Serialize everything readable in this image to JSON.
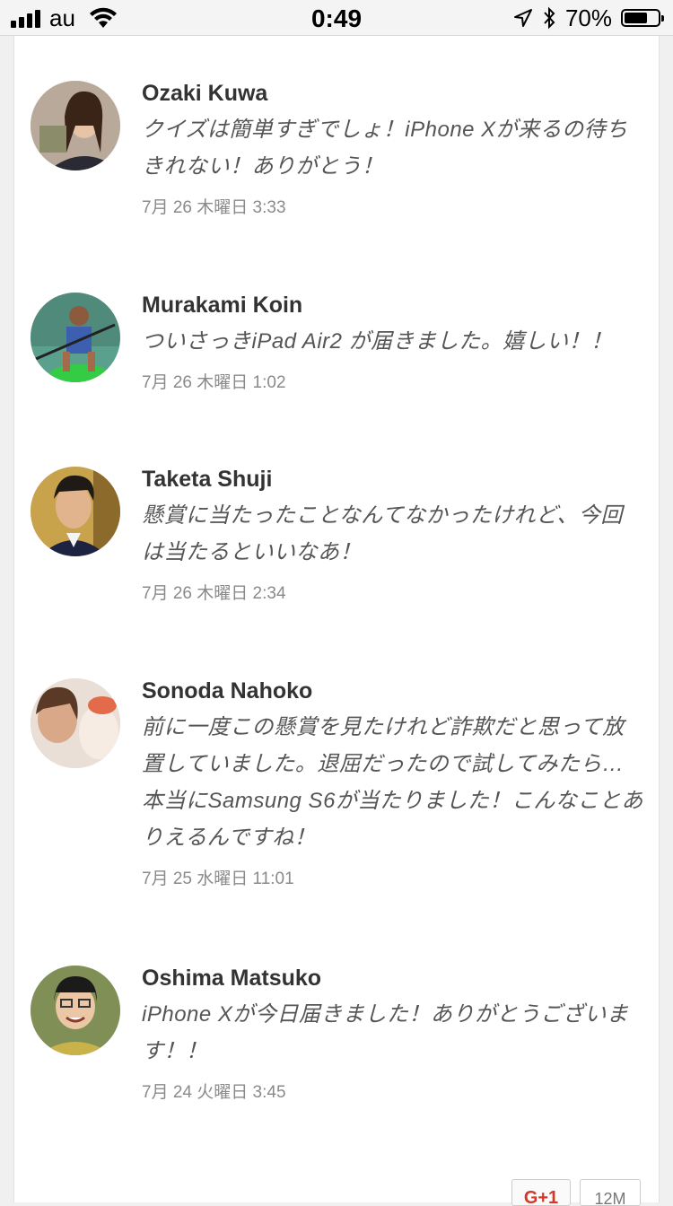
{
  "status_bar": {
    "carrier": "au",
    "time": "0:49",
    "battery_percent": "70%",
    "battery_level": 0.7
  },
  "comments": [
    {
      "name": "Ozaki Kuwa",
      "text": "クイズは簡単すぎでしょ！iPhone Xが来るの待ちきれない！ありがとう！",
      "date": "7月 26 木曜日 3:33"
    },
    {
      "name": "Murakami Koin",
      "text": "ついさっきiPad Air2 が届きました。嬉しい！！",
      "date": "7月 26 木曜日 1:02"
    },
    {
      "name": "Taketa Shuji",
      "text": "懸賞に当たったことなんてなかったけれど、今回は当たるといいなあ！",
      "date": "7月 26 木曜日 2:34"
    },
    {
      "name": "Sonoda Nahoko",
      "text": "前に一度この懸賞を見たけれど詐欺だと思って放置していました。退屈だったので試してみたら…本当にSamsung S6が当たりました！こんなことありえるんですね！",
      "date": "7月 25 水曜日 11:01"
    },
    {
      "name": "Oshima Matsuko",
      "text": "iPhone Xが今日届きました！ありがとうございます！！",
      "date": "7月 24 火曜日 3:45"
    }
  ],
  "share": {
    "gplus_label": "G+1",
    "count_label": "12M"
  }
}
